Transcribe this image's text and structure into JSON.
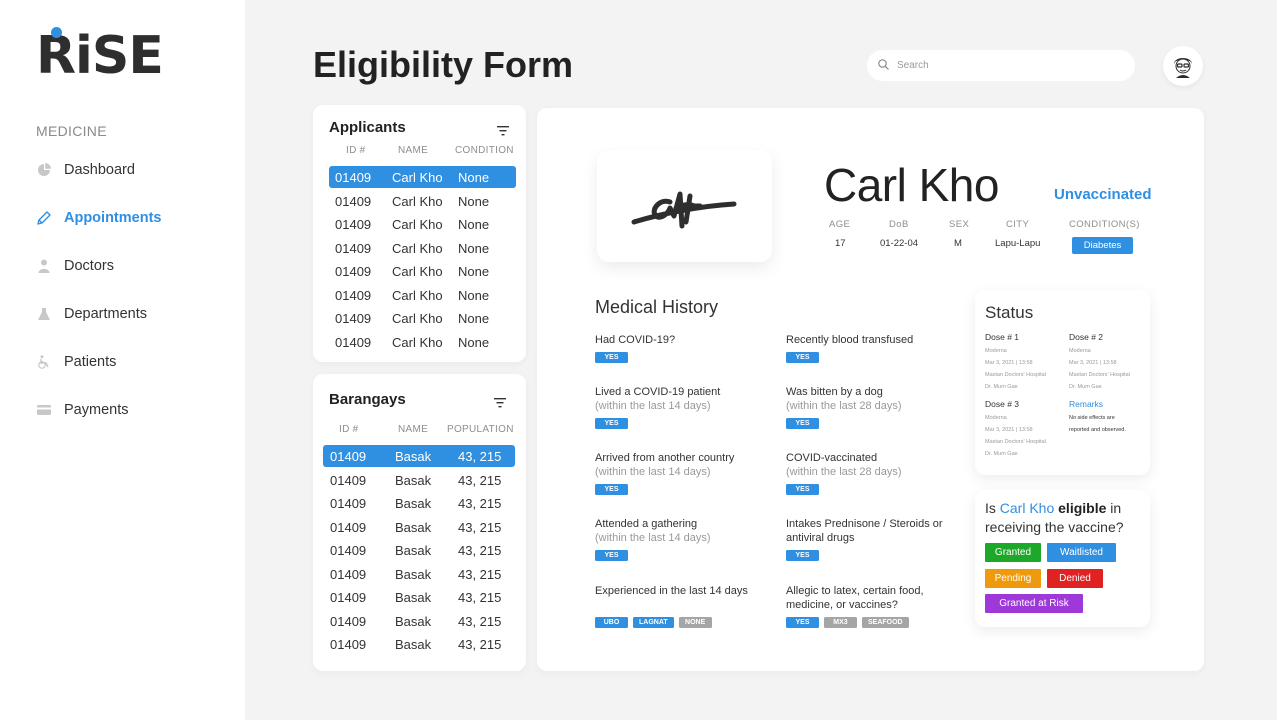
{
  "brand": {
    "logo": "RiSE",
    "accent": "#2f8fe0"
  },
  "sidebar": {
    "section": "MEDICINE",
    "items": [
      {
        "label": "Dashboard",
        "icon": "pie-chart-icon",
        "active": false
      },
      {
        "label": "Appointments",
        "icon": "pencil-icon",
        "active": true
      },
      {
        "label": "Doctors",
        "icon": "person-icon",
        "active": false
      },
      {
        "label": "Departments",
        "icon": "flask-icon",
        "active": false
      },
      {
        "label": "Patients",
        "icon": "wheelchair-icon",
        "active": false
      },
      {
        "label": "Payments",
        "icon": "credit-card-icon",
        "active": false
      }
    ]
  },
  "header": {
    "title": "Eligibility Form",
    "search_placeholder": "Search"
  },
  "applicants": {
    "title": "Applicants",
    "columns": [
      "ID #",
      "NAME",
      "CONDITION"
    ],
    "rows": [
      [
        "01409",
        "Carl Kho",
        "None"
      ],
      [
        "01409",
        "Carl Kho",
        "None"
      ],
      [
        "01409",
        "Carl Kho",
        "None"
      ],
      [
        "01409",
        "Carl Kho",
        "None"
      ],
      [
        "01409",
        "Carl Kho",
        "None"
      ],
      [
        "01409",
        "Carl Kho",
        "None"
      ],
      [
        "01409",
        "Carl Kho",
        "None"
      ],
      [
        "01409",
        "Carl Kho",
        "None"
      ]
    ],
    "selected": 0
  },
  "barangays": {
    "title": "Barangays",
    "columns": [
      "ID #",
      "NAME",
      "POPULATION"
    ],
    "rows": [
      [
        "01409",
        "Basak",
        "43, 215"
      ],
      [
        "01409",
        "Basak",
        "43, 215"
      ],
      [
        "01409",
        "Basak",
        "43, 215"
      ],
      [
        "01409",
        "Basak",
        "43, 215"
      ],
      [
        "01409",
        "Basak",
        "43, 215"
      ],
      [
        "01409",
        "Basak",
        "43, 215"
      ],
      [
        "01409",
        "Basak",
        "43, 215"
      ],
      [
        "01409",
        "Basak",
        "43, 215"
      ],
      [
        "01409",
        "Basak",
        "43, 215"
      ]
    ],
    "selected": 0
  },
  "patient": {
    "name": "Carl Kho",
    "status": "Unvaccinated",
    "labels": {
      "age": "AGE",
      "dob": "DoB",
      "sex": "SEX",
      "city": "CITY",
      "conditions": "CONDITION(S)"
    },
    "age": "17",
    "dob": "01-22-04",
    "sex": "M",
    "city": "Lapu-Lapu",
    "condition": "Diabetes"
  },
  "medical_history": {
    "title": "Medical History",
    "questions": [
      {
        "q": "Had COVID-19?",
        "sub": "",
        "chips": [
          {
            "t": "YES",
            "c": "blue"
          }
        ]
      },
      {
        "q": "Recently blood transfused",
        "sub": "",
        "chips": [
          {
            "t": "YES",
            "c": "blue"
          }
        ]
      },
      {
        "q": "Lived a COVID-19 patient",
        "sub": "(within the last 14 days)",
        "chips": [
          {
            "t": "YES",
            "c": "blue"
          }
        ]
      },
      {
        "q": "Was bitten by a dog",
        "sub": "(within the last 28 days)",
        "chips": [
          {
            "t": "YES",
            "c": "blue"
          }
        ]
      },
      {
        "q": "Arrived from another country",
        "sub": "(within the last 14 days)",
        "chips": [
          {
            "t": "YES",
            "c": "blue"
          }
        ]
      },
      {
        "q": "COVID-vaccinated",
        "sub": "(within the last 28 days)",
        "chips": [
          {
            "t": "YES",
            "c": "blue"
          }
        ]
      },
      {
        "q": "Attended a gathering",
        "sub": "(within the last 14 days)",
        "chips": [
          {
            "t": "YES",
            "c": "blue"
          }
        ]
      },
      {
        "q": "Intakes Prednisone / Steroids or antiviral drugs",
        "sub": "",
        "chips": [
          {
            "t": "YES",
            "c": "blue"
          }
        ]
      },
      {
        "q": "Experienced in the last 14 days",
        "sub": "",
        "chips": [
          {
            "t": "UBO",
            "c": "blue"
          },
          {
            "t": "LAGNAT",
            "c": "blue"
          },
          {
            "t": "NONE",
            "c": "gray"
          }
        ]
      },
      {
        "q": "Allegic to latex, certain food, medicine, or vaccines?",
        "sub": "",
        "chips": [
          {
            "t": "YES",
            "c": "blue"
          },
          {
            "t": "MX3",
            "c": "gray"
          },
          {
            "t": "SEAFOOD",
            "c": "gray"
          }
        ]
      }
    ]
  },
  "status": {
    "title": "Status",
    "doses": [
      {
        "head": "Dose # 1",
        "lines": [
          "Moderna",
          "Mar 3, 2021 | 13:58",
          "Maxtan Doctors' Hospital",
          "Dr. Mum Gae"
        ]
      },
      {
        "head": "Dose # 2",
        "lines": [
          "Moderna",
          "Mar 3, 2021 | 13:58",
          "Maxtan Doctors' Hospital",
          "Dr. Mum Gae"
        ]
      },
      {
        "head": "Dose # 3",
        "lines": [
          "Moderna",
          "Mar 3, 2021 | 13:58",
          "Maxtan Doctors' Hospital",
          "Dr. Mum Gae"
        ]
      }
    ],
    "remarks_title": "Remarks",
    "remarks_lines": [
      "No side effects are",
      "reported and observed."
    ]
  },
  "eligibility": {
    "q_prefix": "Is",
    "q_name": "Carl Kho",
    "q_bold": "eligible",
    "q_rest": "in receiving the vaccine?",
    "buttons": [
      {
        "label": "Granted",
        "color": "#1ea82a"
      },
      {
        "label": "Waitlisted",
        "color": "#2f8fe0"
      },
      {
        "label": "Pending",
        "color": "#ef9a0c"
      },
      {
        "label": "Denied",
        "color": "#e12222"
      },
      {
        "label": "Granted at Risk",
        "color": "#9e38d8"
      }
    ]
  }
}
